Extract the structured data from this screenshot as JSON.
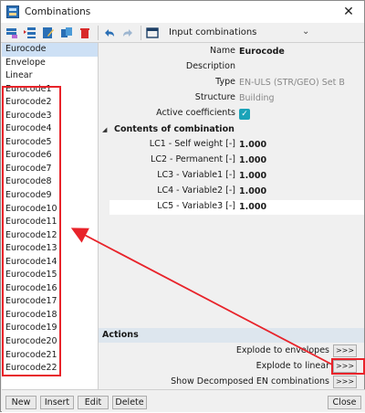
{
  "window": {
    "title": "Combinations",
    "close_glyph": "✕"
  },
  "toolbar": {
    "buttons": [
      "new-icon",
      "insert-icon",
      "edit-icon",
      "copy-icon",
      "delete-icon",
      "undo-icon",
      "redo-icon",
      "table-icon"
    ],
    "label": "Input combinations",
    "dropdown_glyph": "⌄"
  },
  "list": {
    "items": [
      "Eurocode",
      "Envelope",
      "Linear",
      "Eurocode1",
      "Eurocode2",
      "Eurocode3",
      "Eurocode4",
      "Eurocode5",
      "Eurocode6",
      "Eurocode7",
      "Eurocode8",
      "Eurocode9",
      "Eurocode10",
      "Eurocode11",
      "Eurocode12",
      "Eurocode13",
      "Eurocode14",
      "Eurocode15",
      "Eurocode16",
      "Eurocode17",
      "Eurocode18",
      "Eurocode19",
      "Eurocode20",
      "Eurocode21",
      "Eurocode22"
    ],
    "selected_index": 0
  },
  "properties": {
    "name_label": "Name",
    "name_value": "Eurocode",
    "description_label": "Description",
    "description_value": "",
    "type_label": "Type",
    "type_value": "EN-ULS (STR/GEO) Set B",
    "structure_label": "Structure",
    "structure_value": "Building",
    "active_label": "Active coefficients",
    "active_checked": true
  },
  "contents": {
    "header": "Contents of combination",
    "rows": [
      {
        "label": "LC1 - Self weight [-]",
        "value": "1.000"
      },
      {
        "label": "LC2 - Permanent [-]",
        "value": "1.000"
      },
      {
        "label": "LC3 - Variable1 [-]",
        "value": "1.000"
      },
      {
        "label": "LC4 - Variable2 [-]",
        "value": "1.000"
      },
      {
        "label": "LC5 - Variable3 [-]",
        "value": "1.000"
      }
    ]
  },
  "actions": {
    "header": "Actions",
    "rows": [
      {
        "label": "Explode to envelopes",
        "button": ">>>"
      },
      {
        "label": "Explode to linear",
        "button": ">>>"
      },
      {
        "label": "Show Decomposed EN combinations",
        "button": ">>>"
      }
    ]
  },
  "bottom": {
    "new": "New",
    "insert": "Insert",
    "edit": "Edit",
    "delete": "Delete",
    "close": "Close"
  },
  "colors": {
    "highlight": "#e8232a",
    "selection": "#cde0f5",
    "checkbox": "#1aa3b8"
  }
}
